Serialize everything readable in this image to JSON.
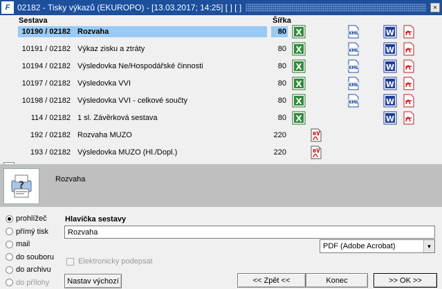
{
  "window": {
    "title": "02182 - Tisky výkazů (EKUROPO) - [13.03.2017; 14:25] [ ] [ ]",
    "app_icon_text": "F",
    "close_label": "×"
  },
  "table": {
    "col_sestava": "Sestava",
    "col_sirka": "Šířka",
    "rows": [
      {
        "code": "10190 / 02182",
        "name": "Rozvaha",
        "width": "80",
        "xls": true,
        "xml": true,
        "word": true,
        "pdf": true,
        "bm": false
      },
      {
        "code": "10191 / 02182",
        "name": "Výkaz zisku a ztráty",
        "width": "80",
        "xls": true,
        "xml": true,
        "word": true,
        "pdf": true,
        "bm": false
      },
      {
        "code": "10194 / 02182",
        "name": "Výsledovka Ne/Hospodářské činnosti",
        "width": "80",
        "xls": true,
        "xml": true,
        "word": true,
        "pdf": true,
        "bm": false
      },
      {
        "code": "10197 / 02182",
        "name": "Výsledovka VVI",
        "width": "80",
        "xls": true,
        "xml": true,
        "word": true,
        "pdf": true,
        "bm": false
      },
      {
        "code": "10198 / 02182",
        "name": "Výsledovka VVI - celkové součty",
        "width": "80",
        "xls": true,
        "xml": true,
        "word": true,
        "pdf": true,
        "bm": false
      },
      {
        "code": "114 / 02182",
        "name": "1 sl. Závěrková sestava",
        "width": "80",
        "xls": true,
        "xml": false,
        "word": true,
        "pdf": true,
        "bm": false
      },
      {
        "code": "192 / 02182",
        "name": "Rozvaha MUZO",
        "width": "220",
        "xls": false,
        "xml": false,
        "word": false,
        "pdf": false,
        "bm": true
      },
      {
        "code": "193 / 02182",
        "name": "Výsledovka MUZO (Hl./Dopl.)",
        "width": "220",
        "xls": false,
        "xml": false,
        "word": false,
        "pdf": false,
        "bm": true
      }
    ]
  },
  "description": {
    "text": "Rozvaha"
  },
  "output_options": [
    {
      "label": "prohlížeč",
      "selected": true,
      "disabled": false
    },
    {
      "label": "přímý tisk",
      "selected": false,
      "disabled": false
    },
    {
      "label": "mail",
      "selected": false,
      "disabled": false
    },
    {
      "label": "do souboru",
      "selected": false,
      "disabled": false
    },
    {
      "label": "do archivu",
      "selected": false,
      "disabled": false
    },
    {
      "label": "do přílohy",
      "selected": false,
      "disabled": true
    }
  ],
  "header_section": {
    "label": "Hlavička sestavy",
    "value": "Rozvaha"
  },
  "format_select": {
    "value": "PDF (Adobe Acrobat)"
  },
  "signature_checkbox": {
    "label": "Elektronicky podepsat",
    "checked": false
  },
  "buttons": {
    "nastav": "Nastav výchozí",
    "zpet": "<< Zpět <<",
    "konec": "Konec",
    "ok": ">> OK >>"
  },
  "icon_labels": {
    "xml": "XML",
    "word": "W",
    "xls": "X",
    "bm": "B"
  },
  "colors": {
    "titlebar": "#1c4f9c",
    "selection": "#99c9f5",
    "description_bg": "#bfbfbf"
  }
}
